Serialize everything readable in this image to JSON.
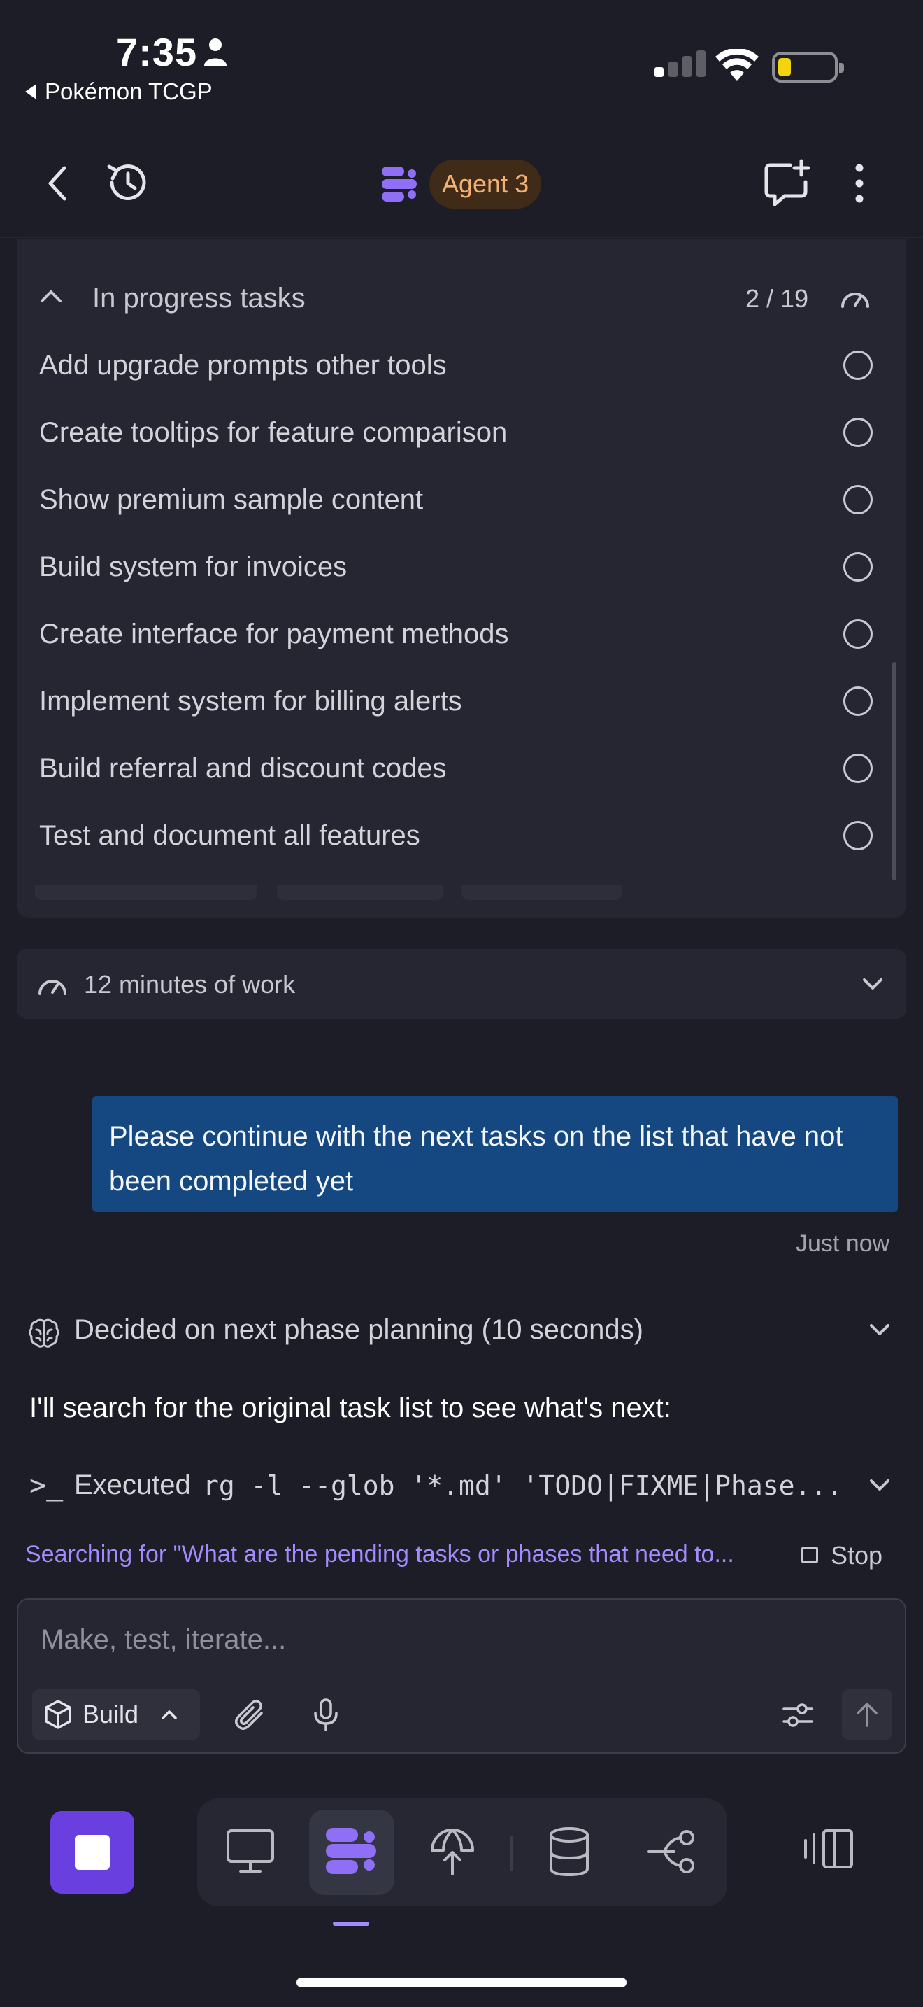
{
  "status_bar": {
    "time": "7:35",
    "back_app": "Pokémon TCGP"
  },
  "header": {
    "agent_name": "Agent 3",
    "icons": [
      "chevron-left-icon",
      "history-icon",
      "agent-logo-icon",
      "new-chat-icon",
      "more-vertical-icon"
    ]
  },
  "tasks": {
    "title": "In progress tasks",
    "count": "2 / 19",
    "items": [
      {
        "label": "Add upgrade prompts other tools",
        "done": false
      },
      {
        "label": "Create tooltips for feature comparison",
        "done": false
      },
      {
        "label": "Show premium sample content",
        "done": false
      },
      {
        "label": "Build system for invoices",
        "done": false
      },
      {
        "label": "Create interface for payment methods",
        "done": false
      },
      {
        "label": "Implement system for billing alerts",
        "done": false
      },
      {
        "label": "Build referral and discount codes",
        "done": false
      },
      {
        "label": "Test and document all features",
        "done": false
      }
    ]
  },
  "work_summary": {
    "label": "12 minutes of work"
  },
  "chat": {
    "user_message": "Please continue with the next tasks on the list that have not been completed yet",
    "user_message_time": "Just now",
    "thinking": "Decided on next phase planning (10 seconds)",
    "agent_text": "I'll search for the original task list to see what's next:",
    "exec_prompt": ">_",
    "exec_label": "Executed",
    "exec_command": "rg -l --glob '*.md' 'TODO|FIXME|Phase...",
    "searching": "Searching for \"What are the pending tasks or phases that need to...",
    "stop_label": "Stop"
  },
  "composer": {
    "placeholder": "Make, test, iterate...",
    "mode_label": "Build"
  },
  "colors": {
    "background": "#1c1d27",
    "card": "#252631",
    "accent": "#6a3fe0",
    "accent_light": "#a48bff",
    "user_bubble": "#154781",
    "agent_pill_bg": "#3f2b17",
    "agent_pill_text": "#f2b174"
  }
}
